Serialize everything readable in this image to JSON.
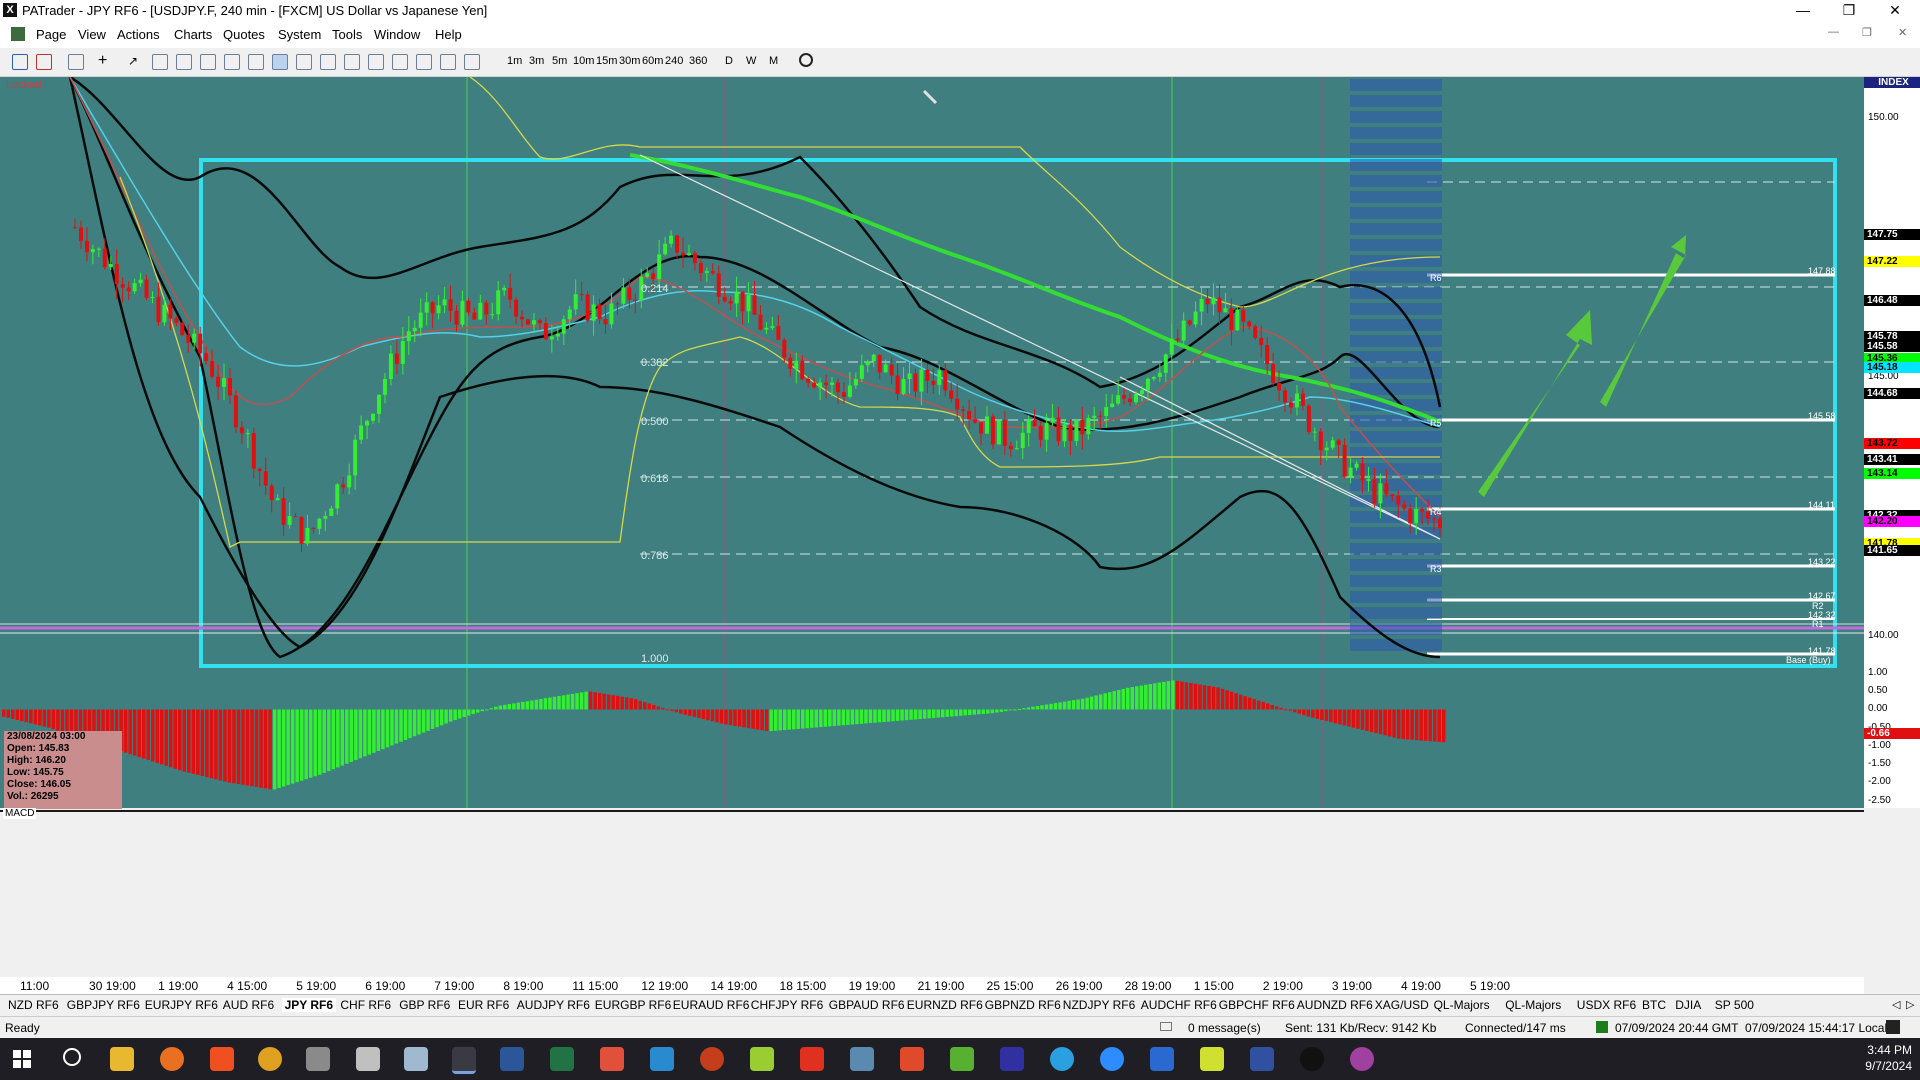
{
  "window": {
    "app_icon": "X",
    "title": "PATrader - JPY RF6 - [USDJPY.F, 240 min - [FXCM] US Dollar vs Japanese Yen]",
    "controls": [
      "minimize-icon",
      "restore-icon",
      "close-icon"
    ]
  },
  "menu": [
    "Page",
    "View",
    "Actions",
    "Charts",
    "Quotes",
    "System",
    "Tools",
    "Window",
    "Help"
  ],
  "toolbar": {
    "timeframes": [
      "1m",
      "3m",
      "5m",
      "10m",
      "15m",
      "30m",
      "60m",
      "240",
      "360",
      "D",
      "W",
      "M"
    ]
  },
  "chart": {
    "locked_label": "Locked",
    "macd_label": "MACD",
    "fib_labels": [
      "0.214",
      "0.382",
      "0.500",
      "0.618",
      "0.786",
      "1.000"
    ],
    "level_labels": [
      {
        "name": "R6",
        "price": "147.88"
      },
      {
        "name": "R5",
        "price": "145.58"
      },
      {
        "name": "R4",
        "price": "144.11"
      },
      {
        "name": "R3",
        "price": "143.22"
      },
      {
        "name": "R2",
        "price": "142.67"
      },
      {
        "name": "R1",
        "price": "142.32"
      },
      {
        "name": "Base (Buy)",
        "price": "141.78"
      }
    ],
    "colors": {
      "background": "#3f7f7f",
      "bull": "#33ee33",
      "bear": "#e01010",
      "box": "#33e0ee",
      "arrow": "#5ac83c"
    }
  },
  "chart_data": [
    {
      "type": "candlestick",
      "title": "USDJPY.F, 240 min - [FXCM] US Dollar vs Japanese Yen",
      "close_path": [
        147.9,
        147.2,
        146.6,
        146.0,
        145.3,
        144.1,
        142.5,
        141.9,
        143.0,
        144.6,
        145.9,
        146.4,
        146.1,
        146.6,
        145.8,
        146.4,
        146.2,
        146.8,
        147.6,
        147.0,
        146.5,
        145.7,
        145.1,
        144.7,
        145.3,
        144.8,
        145.1,
        144.2,
        143.8,
        144.0,
        143.9,
        144.3,
        144.9,
        145.6,
        146.5,
        146.0,
        145.1,
        144.2,
        143.4,
        142.8,
        142.4,
        142.2
      ],
      "x_labels": [
        "11:00",
        "30 19:00",
        "1 19:00",
        "4 15:00",
        "5 19:00",
        "6 19:00",
        "7 19:00",
        "8 19:00",
        "11 15:00",
        "12 19:00",
        "14 19:00",
        "18 15:00",
        "19 19:00",
        "21 19:00",
        "25 15:00",
        "26 19:00",
        "28 19:00",
        "1 15:00",
        "2 19:00",
        "3 19:00",
        "4 19:00",
        "5 19:00"
      ],
      "y_ticks": [
        140.0,
        145.0,
        150.0
      ],
      "ylim": [
        139.6,
        150.8
      ],
      "price_markers": [
        {
          "value": "INDEX",
          "color": "#1a237e"
        },
        {
          "value": "147.75",
          "color": "#000000"
        },
        {
          "value": "147.22",
          "color": "#ffff00"
        },
        {
          "value": "146.48",
          "color": "#000000"
        },
        {
          "value": "145.78",
          "color": "#000000"
        },
        {
          "value": "145.58",
          "color": "#000000"
        },
        {
          "value": "145.36",
          "color": "#00ff00"
        },
        {
          "value": "145.18",
          "color": "#00e5ff"
        },
        {
          "value": "144.68",
          "color": "#000000"
        },
        {
          "value": "143.72",
          "color": "#ff0000"
        },
        {
          "value": "143.41",
          "color": "#000000"
        },
        {
          "value": "143.14",
          "color": "#00ff00"
        },
        {
          "value": "142.32",
          "color": "#000000"
        },
        {
          "value": "142.20",
          "color": "#ff00ff"
        },
        {
          "value": "141.78",
          "color": "#ffff00"
        },
        {
          "value": "141.65",
          "color": "#000000"
        }
      ]
    },
    {
      "type": "bar",
      "title": "MACD",
      "values": [
        -0.2,
        -0.5,
        -0.9,
        -1.3,
        -1.7,
        -2.0,
        -2.2,
        -1.8,
        -1.3,
        -0.8,
        -0.3,
        0.1,
        0.3,
        0.5,
        0.3,
        -0.1,
        -0.4,
        -0.6,
        -0.5,
        -0.4,
        -0.3,
        -0.2,
        -0.1,
        0.1,
        0.3,
        0.6,
        0.8,
        0.6,
        0.2,
        -0.2,
        -0.5,
        -0.8,
        -0.9
      ],
      "y_ticks": [
        1.0,
        0.5,
        0.0,
        -0.5,
        -1.0,
        -1.5,
        -2.0,
        -2.5
      ],
      "ylim": [
        -2.7,
        1.3
      ],
      "value_markers": [
        "-0.66"
      ]
    }
  ],
  "infobox": {
    "date": "23/08/2024 03:00",
    "open": "Open: 145.83",
    "high": "High: 146.20",
    "low": "Low: 145.75",
    "close": "Close: 146.05",
    "vol": "Vol.: 26295"
  },
  "symbol_tabs": [
    "NZD RF6",
    "GBPJPY RF6",
    "EURJPY RF6",
    "AUD RF6",
    "JPY RF6",
    "CHF RF6",
    "GBP RF6",
    "EUR RF6",
    "AUDJPY RF6",
    "EURGBP RF6",
    "EURAUD RF6",
    "CHFJPY RF6",
    "GBPAUD RF6",
    "EURNZD RF6",
    "GBPNZD RF6",
    "NZDJPY RF6",
    "AUDCHF RF6",
    "GBPCHF RF6",
    "AUDNZD RF6",
    "XAG/USD",
    "QL-Majors",
    "QL-Majors",
    "USDX RF6",
    "BTC",
    "DJIA",
    "SP 500"
  ],
  "active_tab": "JPY RF6",
  "status": {
    "ready": "Ready",
    "messages": "0 message(s)",
    "traffic": "Sent: 131 Kb/Recv: 9142 Kb",
    "connection": "Connected/147 ms",
    "gmt": "07/09/2024 20:44 GMT",
    "local": "07/09/2024 15:44:17 Local"
  },
  "taskbar": {
    "time": "3:44 PM",
    "date": "9/7/2024"
  }
}
